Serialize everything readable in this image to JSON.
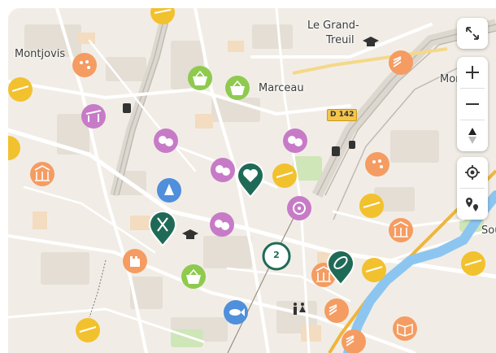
{
  "map": {
    "places": {
      "le_grand": "Le Grand-",
      "treuil": "Treuil",
      "montjovis": "Montjovis",
      "marceau": "Marceau",
      "montjovis_right": "Mor",
      "sou": "Sou"
    },
    "road_shield": "D 142",
    "cluster_count": "2"
  },
  "controls": {
    "fullscreen": "fullscreen-icon",
    "zoom_in": "plus-icon",
    "zoom_out": "minus-icon",
    "compass": "compass-icon",
    "locate": "locate-icon",
    "route": "route-icon"
  },
  "colors": {
    "yellow": "#f2c12e",
    "orange": "#f59c62",
    "purple": "#c77bc7",
    "green": "#8fca4f",
    "blue": "#4f8fdc",
    "marker": "#1f6a57",
    "river": "#8cc6f0"
  }
}
